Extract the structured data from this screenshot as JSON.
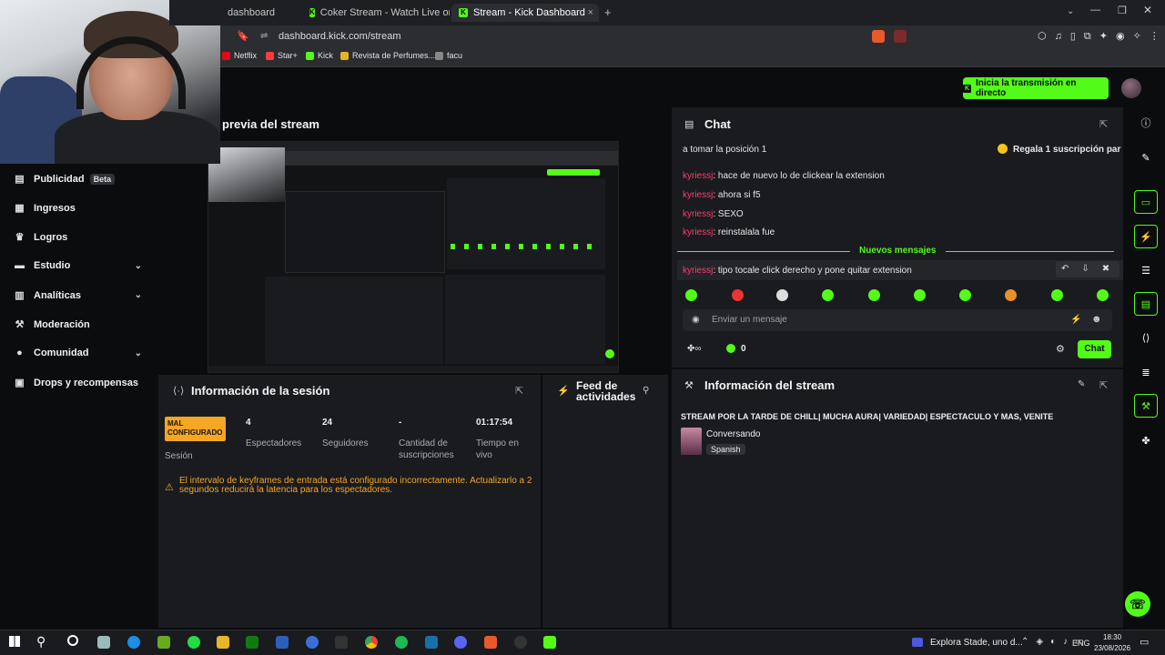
{
  "browser": {
    "tabs": [
      {
        "label": "dashboard"
      },
      {
        "label": "Coker Stream - Watch Live on Kick"
      },
      {
        "label": "Stream - Kick Dashboard"
      }
    ],
    "url": "dashboard.kick.com/stream",
    "bookmarks": [
      "Netflix",
      "Star+",
      "Kick",
      "Revista de Perfumes...",
      "facu"
    ]
  },
  "header": {
    "go_live_label": "Inicia la transmisión en directo"
  },
  "sidebar": {
    "items": [
      {
        "label": "Publicidad",
        "icon": "megaphone-icon",
        "badge": "Beta"
      },
      {
        "label": "Ingresos",
        "icon": "chart-icon"
      },
      {
        "label": "Logros",
        "icon": "trophy-icon"
      },
      {
        "label": "Estudio",
        "icon": "studio-icon"
      },
      {
        "label": "Analíticas",
        "icon": "analytics-icon"
      },
      {
        "label": "Moderación",
        "icon": "gavel-icon"
      },
      {
        "label": "Comunidad",
        "icon": "community-icon"
      },
      {
        "label": "Drops y recompensas",
        "icon": "gift-icon"
      }
    ]
  },
  "preview": {
    "title": "previa del stream"
  },
  "chat": {
    "title": "Chat",
    "pinned_text": "a tomar la posición 1",
    "gift_text": "Regala 1 suscripción par",
    "messages": [
      {
        "user": "kyriessj",
        "text": ": hace de nuevo lo de clickear la extension"
      },
      {
        "user": "kyriessj",
        "text": ": ahora si f5"
      },
      {
        "user": "kyriessj",
        "text": ": SEXO"
      },
      {
        "user": "kyriessj",
        "text": ": reinstalala fue"
      }
    ],
    "new_messages_label": "Nuevos mensajes",
    "latest": {
      "user": "kyriessj",
      "text": ": tipo tocale click derecho y pone quitar extension"
    },
    "input_placeholder": "Enviar un mensaje",
    "viewers_count": "0",
    "send_label": "Chat",
    "accent": "#53fc18"
  },
  "session": {
    "title": "Información de la sesión",
    "status_badge": "MAL CONFIGURADO",
    "status_caption": "Sesión",
    "stats": [
      {
        "value": "4",
        "label": "Espectadores"
      },
      {
        "value": "24",
        "label": "Seguidores"
      },
      {
        "value": "-",
        "label": "Cantidad de suscripciones"
      },
      {
        "value": "01:17:54",
        "label": "Tiempo en vivo"
      }
    ],
    "warning": "El intervalo de keyframes de entrada está configurado incorrectamente. Actualizarlo a 2 segundos reducirá la latencia para los espectadores."
  },
  "feed": {
    "title": "Feed de actividades"
  },
  "stream_info": {
    "title": "Información del stream",
    "stream_title": "STREAM POR LA TARDE DE CHILL| MUCHA AURA| VARIEDAD| ESPECTACULO Y MAS, VENITE",
    "category": "Conversando",
    "language": "Spanish"
  },
  "taskbar": {
    "notification": "Explora Stade, uno d...",
    "lang": "ENG",
    "time": "18:30",
    "date": "23/08/2026"
  }
}
